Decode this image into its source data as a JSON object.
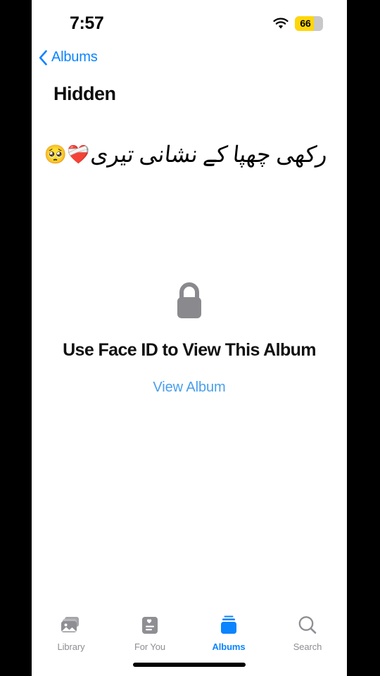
{
  "status_bar": {
    "time": "7:57",
    "wifi_icon": "wifi-icon",
    "battery_percent": "66",
    "battery_color": "#ffd60a",
    "battery_track_color": "#c8c8c8"
  },
  "nav": {
    "back_icon": "chevron-left-icon",
    "back_label": "Albums",
    "title": "Hidden",
    "accent_color": "#0a84ff"
  },
  "caption": {
    "urdu_text": "رکھی چھپا کے نشانی تیری",
    "emoji": "❤️‍🩹🥺"
  },
  "locked_album": {
    "lock_icon": "lock-closed-icon",
    "lock_color": "#8a8a8e",
    "title": "Use Face ID to View This Album",
    "link_label": "View Album",
    "link_color": "#4a9eeb"
  },
  "tab_bar": {
    "active_index": 2,
    "active_color": "#0a84ff",
    "inactive_color": "#8e8e93",
    "items": [
      {
        "label": "Library",
        "icon": "photo-stack-icon"
      },
      {
        "label": "For You",
        "icon": "for-you-card-icon"
      },
      {
        "label": "Albums",
        "icon": "albums-stack-icon"
      },
      {
        "label": "Search",
        "icon": "magnifier-icon"
      }
    ]
  }
}
